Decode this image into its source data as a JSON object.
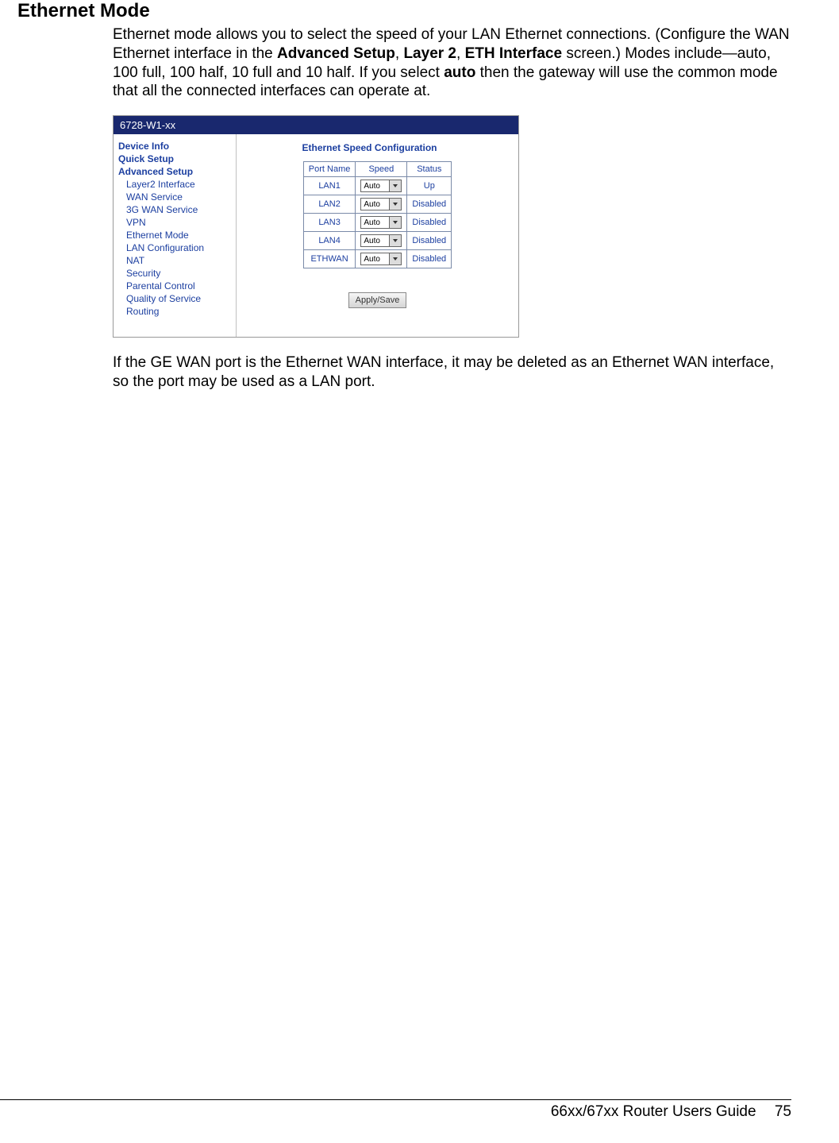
{
  "title": "Ethernet Mode",
  "para1": {
    "t1": "Ethernet mode allows you to select the speed of your LAN Ethernet connections.  (Configure the WAN Ethernet interface in the ",
    "b1": "Advanced Setup",
    "sep1": ", ",
    "b2": "Layer 2",
    "sep2": ", ",
    "b3": "ETH Interface",
    "t2": " screen.)  Modes include—auto, 100 full, 100 half, 10 full and 10 half.  If you select ",
    "b4": "auto",
    "t3": " then the gateway will use the common mode that all the connected interfaces can operate at."
  },
  "router": {
    "header": "6728-W1-xx",
    "nav_top": [
      "Device Info",
      "Quick Setup",
      "Advanced Setup"
    ],
    "nav_sub": [
      "Layer2 Interface",
      "WAN Service",
      "3G WAN Service",
      "VPN",
      "Ethernet Mode",
      "LAN Configuration",
      "NAT",
      "Security",
      "Parental Control",
      "Quality of Service",
      "Routing"
    ],
    "config_title": "Ethernet Speed Configuration",
    "cols": [
      "Port Name",
      "Speed",
      "Status"
    ],
    "rows": [
      {
        "port": "LAN1",
        "speed": "Auto",
        "status": "Up"
      },
      {
        "port": "LAN2",
        "speed": "Auto",
        "status": "Disabled"
      },
      {
        "port": "LAN3",
        "speed": "Auto",
        "status": "Disabled"
      },
      {
        "port": "LAN4",
        "speed": "Auto",
        "status": "Disabled"
      },
      {
        "port": "ETHWAN",
        "speed": "Auto",
        "status": "Disabled"
      }
    ],
    "apply": "Apply/Save"
  },
  "para2": "If the GE WAN port is the Ethernet WAN interface, it may be deleted as an Ethernet WAN interface, so the port may be used as a LAN port.",
  "footer": {
    "guide": "66xx/67xx Router Users Guide",
    "page": "75"
  }
}
